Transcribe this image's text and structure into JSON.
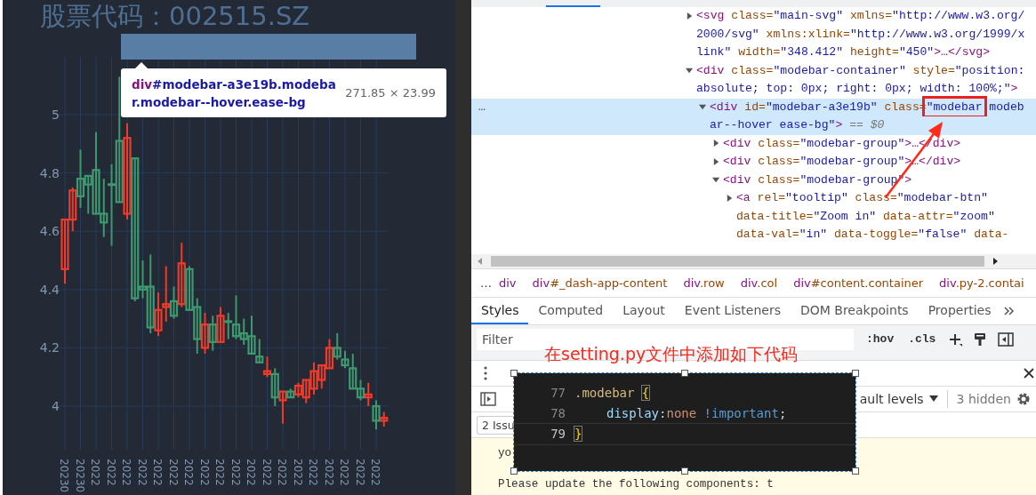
{
  "chart_panel": {
    "title": "股票代码：002515.SZ",
    "chart_data": {
      "type": "candlestick",
      "categories": [
        "20230",
        null,
        "20230",
        null,
        "2022",
        null,
        "2022",
        null,
        "2022",
        null,
        "2022",
        null,
        "2022",
        null,
        "2022",
        null,
        "2022",
        null,
        "2022",
        null,
        "2022",
        null,
        "2022",
        null,
        "2022",
        null,
        "2022",
        null,
        "2022",
        null,
        "2022",
        null,
        "2022",
        null,
        "2022",
        null,
        "2022",
        null,
        "2022",
        null,
        "2022",
        null
      ],
      "yticks": [
        4,
        4.2,
        4.4,
        4.6,
        4.8,
        5
      ],
      "ylim": [
        3.85,
        5.2
      ],
      "grid": true,
      "ohlc": [
        [
          4.47,
          4.64,
          4.42,
          4.64
        ],
        [
          4.64,
          4.75,
          4.6,
          4.74
        ],
        [
          4.78,
          4.88,
          4.68,
          4.72
        ],
        [
          4.79,
          4.79,
          4.66,
          4.76
        ],
        [
          4.81,
          4.94,
          4.66,
          4.66
        ],
        [
          4.66,
          4.78,
          4.58,
          4.63
        ],
        [
          4.76,
          4.83,
          4.55,
          4.76
        ],
        [
          4.91,
          5.13,
          4.7,
          4.7
        ],
        [
          4.66,
          4.97,
          4.64,
          4.92
        ],
        [
          4.85,
          4.85,
          4.36,
          4.37
        ],
        [
          4.41,
          4.5,
          4.37,
          4.4
        ],
        [
          4.41,
          4.52,
          4.25,
          4.27
        ],
        [
          4.26,
          4.39,
          4.24,
          4.33
        ],
        [
          4.34,
          4.48,
          4.29,
          4.35
        ],
        [
          4.36,
          4.41,
          4.3,
          4.31
        ],
        [
          4.35,
          4.56,
          4.34,
          4.49
        ],
        [
          4.47,
          4.48,
          4.33,
          4.33
        ],
        [
          4.34,
          4.37,
          4.18,
          4.23
        ],
        [
          4.2,
          4.32,
          4.18,
          4.28
        ],
        [
          4.28,
          4.31,
          4.19,
          4.22
        ],
        [
          4.22,
          4.34,
          4.22,
          4.31
        ],
        [
          4.29,
          4.32,
          4.23,
          4.29
        ],
        [
          4.28,
          4.38,
          4.23,
          4.24
        ],
        [
          4.25,
          4.3,
          4.21,
          4.23
        ],
        [
          4.24,
          4.31,
          4.18,
          4.18
        ],
        [
          4.17,
          4.23,
          4.15,
          4.15
        ],
        [
          4.11,
          4.17,
          4.1,
          4.12
        ],
        [
          4.11,
          4.13,
          4.0,
          4.03
        ],
        [
          4.02,
          4.05,
          3.94,
          4.05
        ],
        [
          4.05,
          4.06,
          4.03,
          4.03
        ],
        [
          4.04,
          4.08,
          4.03,
          4.07
        ],
        [
          4.03,
          4.09,
          4.01,
          4.09
        ],
        [
          4.06,
          4.15,
          4.04,
          4.12
        ],
        [
          4.09,
          4.14,
          4.06,
          4.14
        ],
        [
          4.13,
          4.23,
          4.13,
          4.2
        ],
        [
          4.2,
          4.25,
          4.16,
          4.17
        ],
        [
          4.16,
          4.19,
          4.13,
          4.14
        ],
        [
          4.13,
          4.18,
          4.06,
          4.06
        ],
        [
          4.06,
          4.09,
          4.02,
          4.03
        ],
        [
          4.03,
          4.08,
          4.0,
          4.04
        ],
        [
          4.0,
          4.02,
          3.92,
          3.95
        ],
        [
          3.95,
          3.98,
          3.93,
          3.96
        ]
      ]
    },
    "inspect_tooltip": {
      "tag": "div",
      "selector_lines": [
        "#modebar-a3e19b.modeba",
        "r.modebar--hover.ease-bg"
      ],
      "size": "271.85 × 23.99"
    }
  },
  "elements_tree": [
    {
      "expanded": false,
      "selected": false,
      "lines": [
        [
          {
            "kind": "tag",
            "text": "<svg"
          },
          {
            "kind": "attr",
            "text": " class="
          },
          {
            "kind": "value",
            "text": "\"main-svg\""
          },
          {
            "kind": "attr",
            "text": " xmlns="
          },
          {
            "kind": "value",
            "text": "\"http://www.w3.org/"
          }
        ],
        [
          {
            "kind": "value",
            "text": "2000/svg\""
          },
          {
            "kind": "attr",
            "text": " xmlns:xlink="
          },
          {
            "kind": "value",
            "text": "\"http://www.w3.org/1999/x"
          }
        ],
        [
          {
            "kind": "value",
            "text": "link\""
          },
          {
            "kind": "attr",
            "text": " width="
          },
          {
            "kind": "value",
            "text": "\"348.412\""
          },
          {
            "kind": "attr",
            "text": " height="
          },
          {
            "kind": "value",
            "text": "\"450\""
          },
          {
            "kind": "tag",
            "text": ">…</svg>"
          }
        ]
      ]
    },
    {
      "expanded": true,
      "selected": false,
      "lines": [
        [
          {
            "kind": "tag",
            "text": "<div"
          },
          {
            "kind": "attr",
            "text": " class="
          },
          {
            "kind": "value",
            "text": "\"modebar-container\""
          },
          {
            "kind": "attr",
            "text": " style="
          },
          {
            "kind": "value",
            "text": "\"position:"
          }
        ],
        [
          {
            "kind": "value",
            "text": "absolute; top: 0px; right: 0px; width: 100%;\""
          },
          {
            "kind": "tag",
            "text": ">"
          }
        ]
      ],
      "children": [
        {
          "expanded": true,
          "selected": true,
          "gutter": "…",
          "lines": [
            [
              {
                "kind": "tag",
                "text": "<div"
              },
              {
                "kind": "attr",
                "text": " id="
              },
              {
                "kind": "value",
                "text": "\"modebar-a3e19b\""
              },
              {
                "kind": "attr",
                "text": " class="
              },
              {
                "kind": "boxed-value",
                "text": "\"modebar"
              },
              {
                "kind": "value",
                "text": " modeb"
              }
            ],
            [
              {
                "kind": "value",
                "text": "ar--hover ease-bg\""
              },
              {
                "kind": "tag",
                "text": ">"
              },
              {
                "kind": "hint",
                "text": " == $0"
              }
            ]
          ],
          "children": [
            {
              "expanded": false,
              "selected": false,
              "lines": [
                [
                  {
                    "kind": "tag",
                    "text": "<div"
                  },
                  {
                    "kind": "attr",
                    "text": " class="
                  },
                  {
                    "kind": "value",
                    "text": "\"modebar-group\""
                  },
                  {
                    "kind": "tag",
                    "text": ">…</div>"
                  }
                ]
              ]
            },
            {
              "expanded": false,
              "selected": false,
              "lines": [
                [
                  {
                    "kind": "tag",
                    "text": "<div"
                  },
                  {
                    "kind": "attr",
                    "text": " class="
                  },
                  {
                    "kind": "value",
                    "text": "\"modebar-group\""
                  },
                  {
                    "kind": "tag",
                    "text": ">…</div>"
                  }
                ]
              ]
            },
            {
              "expanded": true,
              "selected": false,
              "lines": [
                [
                  {
                    "kind": "tag",
                    "text": "<div"
                  },
                  {
                    "kind": "attr",
                    "text": " class="
                  },
                  {
                    "kind": "value",
                    "text": "\"modebar-group\""
                  },
                  {
                    "kind": "tag",
                    "text": ">"
                  }
                ]
              ],
              "children": [
                {
                  "expanded": false,
                  "selected": false,
                  "lines": [
                    [
                      {
                        "kind": "tag",
                        "text": "<a"
                      },
                      {
                        "kind": "attr",
                        "text": " rel="
                      },
                      {
                        "kind": "value",
                        "text": "\"tooltip\""
                      },
                      {
                        "kind": "attr",
                        "text": " class="
                      },
                      {
                        "kind": "value",
                        "text": "\"modebar-btn\""
                      }
                    ],
                    [
                      {
                        "kind": "attr",
                        "text": "data-title="
                      },
                      {
                        "kind": "value",
                        "text": "\"Zoom in\""
                      },
                      {
                        "kind": "attr",
                        "text": " data-attr="
                      },
                      {
                        "kind": "value",
                        "text": "\"zoom\""
                      }
                    ],
                    [
                      {
                        "kind": "attr",
                        "text": "data-val="
                      },
                      {
                        "kind": "value",
                        "text": "\"in\""
                      },
                      {
                        "kind": "attr",
                        "text": " data-toggle="
                      },
                      {
                        "kind": "value",
                        "text": "\"false\""
                      },
                      {
                        "kind": "attr",
                        "text": " data-"
                      }
                    ]
                  ]
                }
              ]
            }
          ]
        }
      ]
    }
  ],
  "breadcrumbs": [
    {
      "tag": "div"
    },
    {
      "tag": "div",
      "rest": "#_dash-app-content"
    },
    {
      "tag": "div",
      "rest": ".row"
    },
    {
      "tag": "div",
      "rest": ".col"
    },
    {
      "tag": "div",
      "rest": "#content.container"
    },
    {
      "tag": "div",
      "rest": ".py-2.contai"
    }
  ],
  "breadcrumb_overflow": "…",
  "sidebar_tabs": [
    {
      "label": "Styles",
      "selected": true
    },
    {
      "label": "Computed",
      "selected": false
    },
    {
      "label": "Layout",
      "selected": false
    },
    {
      "label": "Event Listeners",
      "selected": false
    },
    {
      "label": "DOM Breakpoints",
      "selected": false
    },
    {
      "label": "Properties",
      "selected": false
    }
  ],
  "filter": {
    "placeholder": "Filter",
    "buttons": [
      ":hov",
      ".cls"
    ]
  },
  "annotation": "在setting.py文件中添加如下代码",
  "console_toolbar": {
    "levels": "ault levels",
    "hidden_count": "3 hidden",
    "issues": "2 Issu"
  },
  "console_messages": [
    "yo",
    "Please update the following components: t"
  ],
  "code_snippet": [
    {
      "number": "77",
      "current": false,
      "segments": [
        {
          "kind": "selector",
          "text": ".modebar "
        },
        {
          "kind": "brace",
          "text": "{"
        }
      ]
    },
    {
      "number": "78",
      "current": false,
      "segments": [
        {
          "kind": "property",
          "text": "display"
        },
        {
          "kind": "punct",
          "text": ":"
        },
        {
          "kind": "string",
          "text": "none "
        },
        {
          "kind": "keyword",
          "text": "!important"
        },
        {
          "kind": "punct",
          "text": ";"
        }
      ]
    },
    {
      "number": "79",
      "current": true,
      "segments": [
        {
          "kind": "brace",
          "text": "}"
        }
      ]
    }
  ]
}
